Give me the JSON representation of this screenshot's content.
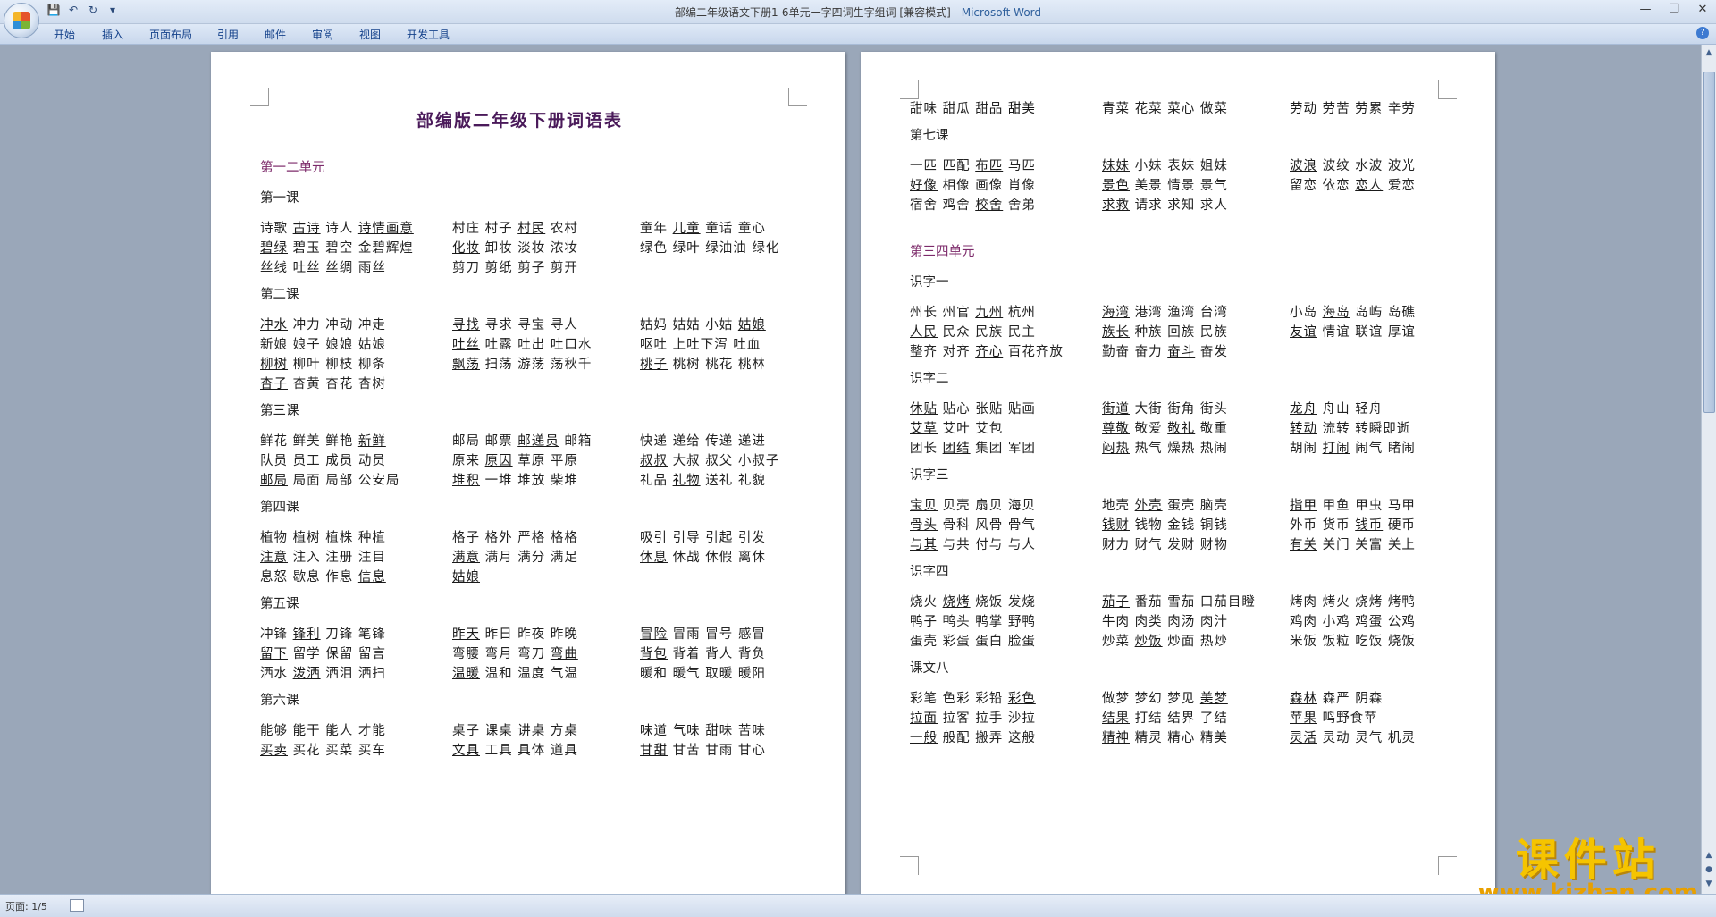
{
  "window": {
    "title": "部编二年级语文下册1-6单元一字四词生字组词 [兼容模式]",
    "app_name": "Microsoft Word",
    "accent": "#15428b"
  },
  "ribbon": {
    "tabs": [
      "开始",
      "插入",
      "页面布局",
      "引用",
      "邮件",
      "审阅",
      "视图",
      "开发工具"
    ]
  },
  "doc": {
    "title": "部编版二年级下册词语表",
    "left": [
      {
        "type": "unit",
        "text": "第一二单元"
      },
      {
        "type": "lesson",
        "text": "第一课"
      },
      {
        "type": "words",
        "groups": [
          [
            "诗歌 ",
            "古诗",
            "诗人",
            "诗情画意"
          ],
          [
            "村庄 村子 ",
            "村民",
            "农村"
          ],
          [
            "童年 ",
            "儿童",
            "童话 童心"
          ]
        ]
      },
      {
        "type": "words",
        "groups": [
          [
            "",
            "碧绿",
            "碧玉 碧空 金碧辉煌"
          ],
          [
            "",
            "化妆",
            "卸妆 淡妆 浓妆"
          ],
          [
            "绿色 绿叶 绿油油 绿化"
          ]
        ]
      },
      {
        "type": "words",
        "groups": [
          [
            "丝线 ",
            "吐丝",
            "丝绸 雨丝"
          ],
          [
            "剪刀 ",
            "剪纸",
            "剪子 剪开"
          ]
        ]
      },
      {
        "type": "lesson",
        "text": "第二课"
      },
      {
        "type": "words",
        "groups": [
          [
            "",
            "冲水",
            "冲力 冲动 冲走"
          ],
          [
            "",
            "寻找",
            "寻求 寻宝 寻人"
          ],
          [
            "姑妈 姑姑 小姑 ",
            "姑娘"
          ]
        ]
      },
      {
        "type": "words",
        "groups": [
          [
            "新娘 娘子 娘娘 姑娘"
          ],
          [
            "",
            "吐丝",
            "吐露 吐出 吐口水"
          ],
          [
            "呕吐 上吐下泻 吐血"
          ]
        ]
      },
      {
        "type": "words",
        "groups": [
          [
            "",
            "柳树",
            "柳叶 柳枝 柳条"
          ],
          [
            "",
            "飘荡",
            "扫荡 游荡 荡秋千"
          ],
          [
            "",
            "桃子",
            "桃树 桃花 桃林"
          ]
        ]
      },
      {
        "type": "words",
        "groups": [
          [
            "",
            "杏子",
            "杏黄 杏花 杏树"
          ]
        ]
      },
      {
        "type": "lesson",
        "text": "第三课"
      },
      {
        "type": "words",
        "groups": [
          [
            "鲜花 鲜美 鲜艳 ",
            "新鲜"
          ],
          [
            "邮局 邮票 ",
            "邮递员",
            "邮箱"
          ],
          [
            "快递 递给 传递 递进"
          ]
        ]
      },
      {
        "type": "words",
        "groups": [
          [
            "队员 员工 成员 动员"
          ],
          [
            "原来 ",
            "原因",
            "草原 平原"
          ],
          [
            "",
            "叔叔",
            "大叔 叔父 小叔子"
          ]
        ]
      },
      {
        "type": "words",
        "groups": [
          [
            "",
            "邮局",
            "局面 局部 公安局"
          ],
          [
            "",
            "堆积",
            "一堆 堆放 柴堆"
          ],
          [
            "礼品 ",
            "礼物",
            "送礼 礼貌"
          ]
        ]
      },
      {
        "type": "lesson",
        "text": "第四课"
      },
      {
        "type": "words",
        "groups": [
          [
            "植物 ",
            "植树",
            "植株 种植"
          ],
          [
            "格子 ",
            "格外",
            "严格 格格"
          ],
          [
            "",
            "吸引",
            "引导 引起 引发"
          ]
        ]
      },
      {
        "type": "words",
        "groups": [
          [
            "",
            "注意",
            "注入 注册 注目"
          ],
          [
            "",
            "满意",
            "满月 满分 满足"
          ],
          [
            "",
            "休息",
            "休战 休假 离休"
          ]
        ]
      },
      {
        "type": "words",
        "groups": [
          [
            "息怒 歇息 作息 ",
            "信息"
          ],
          [
            "",
            "姑娘"
          ]
        ]
      },
      {
        "type": "lesson",
        "text": "第五课"
      },
      {
        "type": "words",
        "groups": [
          [
            "冲锋 ",
            "锋利",
            "刀锋 笔锋"
          ],
          [
            "",
            "昨天",
            "昨日 昨夜 昨晚"
          ],
          [
            "",
            "冒险",
            "冒雨 冒号 感冒"
          ]
        ]
      },
      {
        "type": "words",
        "groups": [
          [
            "",
            "留下",
            "留学 保留 留言"
          ],
          [
            "弯腰 弯月 弯刀 ",
            "弯曲"
          ],
          [
            "",
            "背包",
            "背着 背人 背负"
          ]
        ]
      },
      {
        "type": "words",
        "groups": [
          [
            "洒水 ",
            "泼洒",
            "洒泪 洒扫"
          ],
          [
            "",
            "温暖",
            "温和 温度 气温"
          ],
          [
            "暖和 暖气 取暖 暖阳"
          ]
        ]
      },
      {
        "type": "lesson",
        "text": "第六课"
      },
      {
        "type": "words",
        "groups": [
          [
            "能够 ",
            "能干",
            "能人 才能"
          ],
          [
            "桌子 ",
            "课桌",
            "讲桌 方桌"
          ],
          [
            "",
            "味道",
            "气味 甜味 苦味"
          ]
        ]
      },
      {
        "type": "words",
        "groups": [
          [
            "",
            "买卖",
            "买花 买菜 买车"
          ],
          [
            "",
            "文具",
            "工具 具体 道具"
          ],
          [
            "",
            "甘甜",
            "甘苦 甘雨 甘心"
          ]
        ]
      }
    ],
    "right": [
      {
        "type": "words",
        "groups": [
          [
            "甜味 甜瓜 甜品 ",
            "甜美"
          ],
          [
            "",
            "青菜",
            "花菜 菜心 做菜"
          ],
          [
            "",
            "劳动",
            "劳苦 劳累 辛劳"
          ]
        ]
      },
      {
        "type": "lesson",
        "text": "第七课"
      },
      {
        "type": "words",
        "groups": [
          [
            "一匹 匹配 ",
            "布匹",
            "马匹"
          ],
          [
            "",
            "妹妹",
            "小妹 表妹 姐妹"
          ],
          [
            "",
            "波浪",
            "波纹 水波 波光"
          ]
        ]
      },
      {
        "type": "words",
        "groups": [
          [
            "",
            "好像",
            "相像 画像 肖像"
          ],
          [
            "",
            "景色",
            "美景 情景 景气"
          ],
          [
            "留恋 依恋 ",
            "恋人",
            "爱恋"
          ]
        ]
      },
      {
        "type": "words",
        "groups": [
          [
            "宿舍 鸡舍 ",
            "校舍",
            "舍弟"
          ],
          [
            "",
            "求救",
            "请求 求知 求人"
          ]
        ]
      },
      {
        "type": "words",
        "groups": [
          [
            ""
          ]
        ]
      },
      {
        "type": "unit",
        "text": "第三四单元"
      },
      {
        "type": "lesson",
        "text": "识字一"
      },
      {
        "type": "words",
        "groups": [
          [
            "州长 州官 ",
            "九州",
            "杭州"
          ],
          [
            "",
            "海湾",
            "港湾 渔湾 台湾"
          ],
          [
            "小岛 ",
            "海岛",
            "岛屿 岛礁"
          ]
        ]
      },
      {
        "type": "words",
        "groups": [
          [
            "",
            "人民",
            "民众 民族 民主"
          ],
          [
            "",
            "族长",
            "种族 回族 民族"
          ],
          [
            "",
            "友谊",
            "情谊 联谊 厚谊"
          ]
        ]
      },
      {
        "type": "words",
        "groups": [
          [
            "整齐 对齐 ",
            "齐心",
            "百花齐放"
          ],
          [
            "勤奋 奋力 ",
            "奋斗",
            "奋发"
          ]
        ]
      },
      {
        "type": "lesson",
        "text": "识字二"
      },
      {
        "type": "words",
        "groups": [
          [
            "",
            "休贴",
            "贴心 张贴 贴画"
          ],
          [
            "",
            "街道",
            "大街 街角 街头"
          ],
          [
            "",
            "龙舟",
            "舟山 轻舟"
          ]
        ]
      },
      {
        "type": "words",
        "groups": [
          [
            "",
            "艾草",
            "艾叶 艾包"
          ],
          [
            "",
            "尊敬",
            "敬爱 ",
            "敬礼",
            "敬重"
          ],
          [
            "",
            "转动",
            "流转 转瞬即逝"
          ]
        ]
      },
      {
        "type": "words",
        "groups": [
          [
            "团长 ",
            "团结",
            "集团 军团"
          ],
          [
            "",
            "闷热",
            "热气 燥热 热闹"
          ],
          [
            "胡闹 ",
            "打闹",
            "闹气 睹闹"
          ]
        ]
      },
      {
        "type": "lesson",
        "text": "识字三"
      },
      {
        "type": "words",
        "groups": [
          [
            "",
            "宝贝",
            "贝壳 扇贝 海贝"
          ],
          [
            "地壳 ",
            "外壳",
            "蛋壳 脑壳"
          ],
          [
            "",
            "指甲",
            "甲鱼 甲虫 马甲"
          ]
        ]
      },
      {
        "type": "words",
        "groups": [
          [
            "",
            "骨头",
            "骨科 风骨 骨气"
          ],
          [
            "",
            "钱财",
            "钱物 金钱 铜钱"
          ],
          [
            "外币 货币 ",
            "钱币",
            "硬币"
          ]
        ]
      },
      {
        "type": "words",
        "groups": [
          [
            "",
            "与其",
            "与共 付与 与人"
          ],
          [
            "财力 财气 发财 财物"
          ],
          [
            "",
            "有关",
            "关门 关富 关上"
          ]
        ]
      },
      {
        "type": "lesson",
        "text": "识字四"
      },
      {
        "type": "words",
        "groups": [
          [
            "烧火 ",
            "烧烤",
            "烧饭 发烧"
          ],
          [
            "",
            "茄子",
            "番茄 雪茄 口茄目瞪"
          ],
          [
            "烤肉 烤火 烧烤 烤鸭"
          ]
        ]
      },
      {
        "type": "words",
        "groups": [
          [
            "",
            "鸭子",
            "鸭头 鸭掌 野鸭"
          ],
          [
            "",
            "牛肉",
            "肉类 肉汤 肉汁"
          ],
          [
            "鸡肉 小鸡 ",
            "鸡蛋",
            "公鸡"
          ]
        ]
      },
      {
        "type": "words",
        "groups": [
          [
            "蛋壳 彩蛋 蛋白 脸蛋"
          ],
          [
            "炒菜 ",
            "炒饭",
            "炒面 热炒"
          ],
          [
            "米饭 饭粒 吃饭 烧饭"
          ]
        ]
      },
      {
        "type": "lesson",
        "text": "课文八"
      },
      {
        "type": "words",
        "groups": [
          [
            "彩笔 色彩 彩铅 ",
            "彩色"
          ],
          [
            "做梦 梦幻 梦见 ",
            "美梦"
          ],
          [
            "",
            "森林",
            "森严 阴森"
          ]
        ]
      },
      {
        "type": "words",
        "groups": [
          [
            "",
            "拉面",
            "拉客 拉手 沙拉"
          ],
          [
            "",
            "结果",
            "打结 结界 了结"
          ],
          [
            "",
            "苹果",
            "鸣野食苹"
          ]
        ]
      },
      {
        "type": "words",
        "groups": [
          [
            "",
            "一般",
            "般配 搬弄 这般"
          ],
          [
            "",
            "精神",
            "精灵 精心 精美"
          ],
          [
            "",
            "灵活",
            "灵动 灵气 机灵"
          ]
        ]
      }
    ]
  },
  "status": {
    "page": "页面: 1/5"
  },
  "watermark": {
    "cn": "课件站",
    "url": "www.kjzhan.com"
  }
}
